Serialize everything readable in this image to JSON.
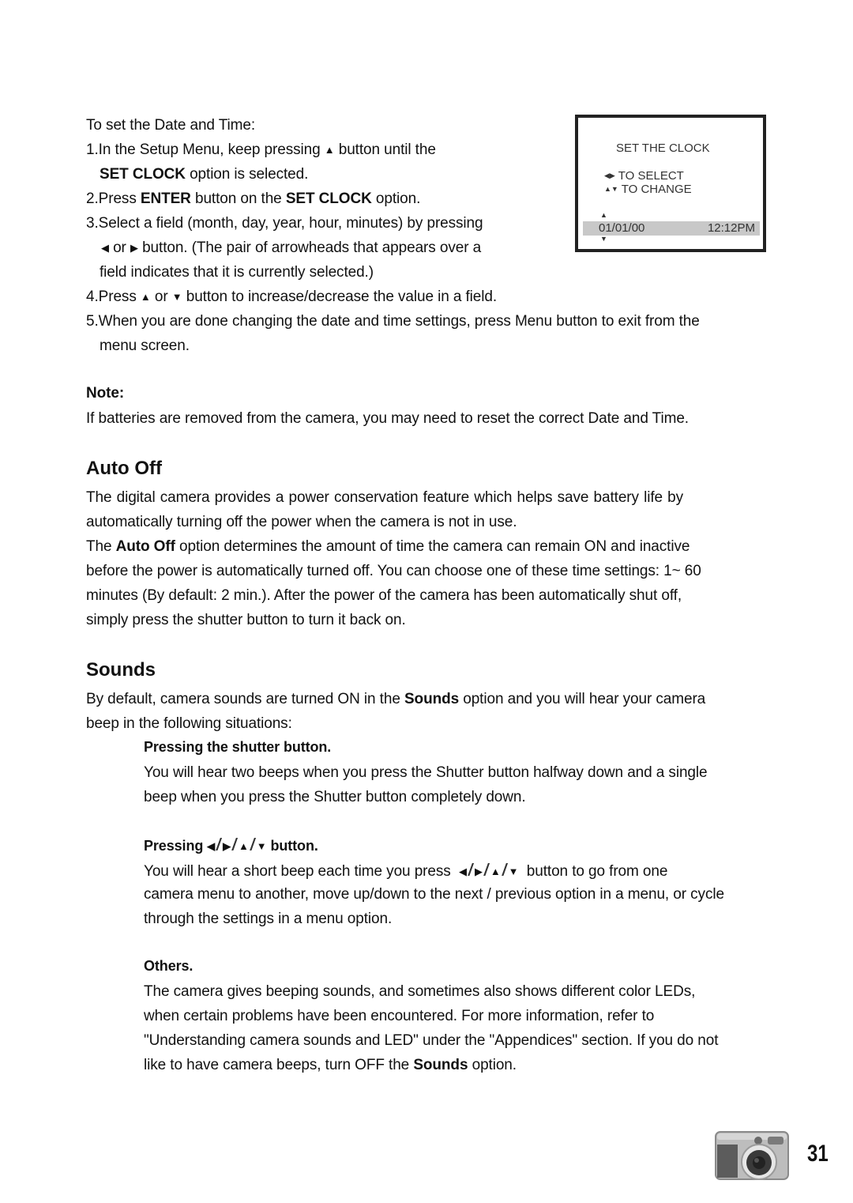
{
  "clock_section": {
    "intro": "To set the Date and Time:",
    "step1_a": "1.In the Setup Menu, keep pressing",
    "step1_b": "button until the",
    "step1_c_bold": "SET CLOCK",
    "step1_c": "option is selected.",
    "step2_a": "2.Press",
    "step2_b_bold": "ENTER",
    "step2_c": "button on the",
    "step2_d_bold": "SET CLOCK",
    "step2_e": "option.",
    "step3_a": "3.Select a field (month, day, year, hour, minutes) by pressing",
    "step3_or": "or",
    "step3_b": "button. (The pair of arrowheads that appears over a",
    "step3_c": "field indicates that it is currently selected.)",
    "step4_a": "4.Press",
    "step4_or": "or",
    "step4_b": "button to increase/decrease the value in a field.",
    "step5_a": "5.When you are done changing the date and time settings, press Menu button to exit from the",
    "step5_b": "menu screen.",
    "note_label": "Note:",
    "note_text": "If batteries are removed from the camera, you may need to reset the correct Date and Time."
  },
  "lcd": {
    "title": "SET THE CLOCK",
    "select_label": "TO SELECT",
    "change_label": "TO CHANGE",
    "date": "01/01/00",
    "time": "12:12PM"
  },
  "icons": {
    "up": "▲",
    "down": "▼",
    "left": "◀",
    "right": "▶",
    "slash": "/"
  },
  "auto_off": {
    "heading": "Auto Off",
    "p1_l1": "The digital camera provides a power conservation feature which helps save battery life by",
    "p1_l2": "automatically turning off the power when the camera is not in use.",
    "p2_a": "The",
    "p2_bold": "Auto Off",
    "p2_b": "option determines the amount of time the camera can remain ON and inactive",
    "p2_l2": "before the power is automatically turned off. You can choose one of these time settings: 1~ 60",
    "p2_l3": "minutes (By default: 2 min.). After the power of the camera has been automatically shut off,",
    "p2_l4": "simply press the shutter button to turn it back on."
  },
  "sounds": {
    "heading": "Sounds",
    "p1_a": "By default, camera sounds are turned ON in the",
    "p1_bold": "Sounds",
    "p1_b": "option and you will hear your camera",
    "p1_l2": "beep in the following situations:",
    "shutter_heading": "Pressing the shutter button.",
    "shutter_l1": "You will hear two beeps when you press the Shutter button halfway down and a single",
    "shutter_l2": "beep when you press the Shutter button completely down.",
    "arrows_heading_a": "Pressing",
    "arrows_heading_b": "button.",
    "arrows_l1_a": "You will hear a short beep each time you press",
    "arrows_l1_b": "button to go from one",
    "arrows_l2": "camera menu to another, move up/down to the next / previous option in a menu, or cycle",
    "arrows_l3": "through the settings in a menu option.",
    "others_heading": "Others.",
    "others_l1": "The camera gives beeping sounds, and sometimes also shows different color LEDs,",
    "others_l2": "when certain problems have been encountered. For more information, refer to",
    "others_l3": "\"Understanding camera sounds and LED\" under the \"Appendices\" section. If you do not",
    "others_l4_a": "like to have camera beeps, turn OFF the",
    "others_l4_bold": "Sounds",
    "others_l4_b": "option."
  },
  "footer": {
    "page_number": "31"
  }
}
